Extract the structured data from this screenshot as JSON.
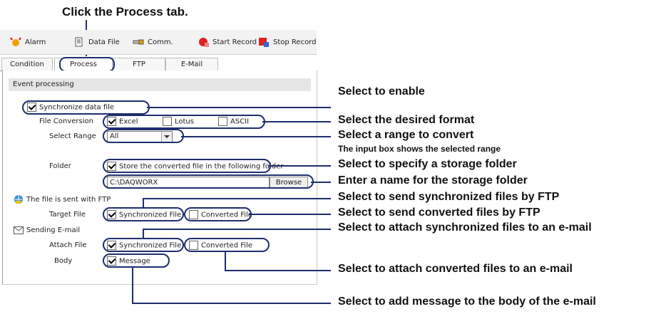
{
  "instruction": "Click the Process tab.",
  "toolbar": {
    "items": [
      {
        "label": "Alarm",
        "icon": "alarm-icon"
      },
      {
        "label": "Data File",
        "icon": "data-file-icon"
      },
      {
        "label": "Comm.",
        "icon": "comm-icon"
      },
      {
        "label": "Start Record",
        "icon": "start-record-icon"
      },
      {
        "label": "Stop Record",
        "icon": "stop-record-icon"
      }
    ]
  },
  "tabs": [
    "Condition",
    "Process",
    "FTP",
    "E-Mail"
  ],
  "section": "Event processing",
  "form": {
    "sync_label": "Synchronize data file",
    "file_conversion_label": "File Conversion",
    "fmt_excel": "Excel",
    "fmt_lotus": "Lotus",
    "fmt_ascii": "ASCII",
    "select_range_label": "Select Range",
    "select_range_value": "All",
    "folder_label": "Folder",
    "store_label": "Store the converted file in the following folder",
    "folder_path": "C:\\DAQWORX",
    "browse_label": "Browse",
    "ftp_label": "The file is sent with FTP",
    "target_file_label": "Target File",
    "ftp_sync_label": "Synchronized File",
    "ftp_conv_label": "Converted File",
    "email_label": "Sending E-mail",
    "attach_file_label": "Attach File",
    "email_sync_label": "Synchronized File",
    "email_conv_label": "Converted File",
    "body_label": "Body",
    "message_label": "Message"
  },
  "callouts": {
    "enable": "Select to enable",
    "format": "Select the desired format",
    "range": "Select a range to convert",
    "range_note": "The input box shows the selected range",
    "storage": "Select to specify a storage folder",
    "name": "Enter a name for the storage folder",
    "ftp_sync": "Select to send synchronized files by FTP",
    "ftp_conv": "Select to send converted files by FTP",
    "email_sync": "Select to attach synchronized files to an e-mail",
    "email_conv": "Select to attach converted files to an e-mail",
    "message": "Select to add message to the body of the e-mail"
  }
}
